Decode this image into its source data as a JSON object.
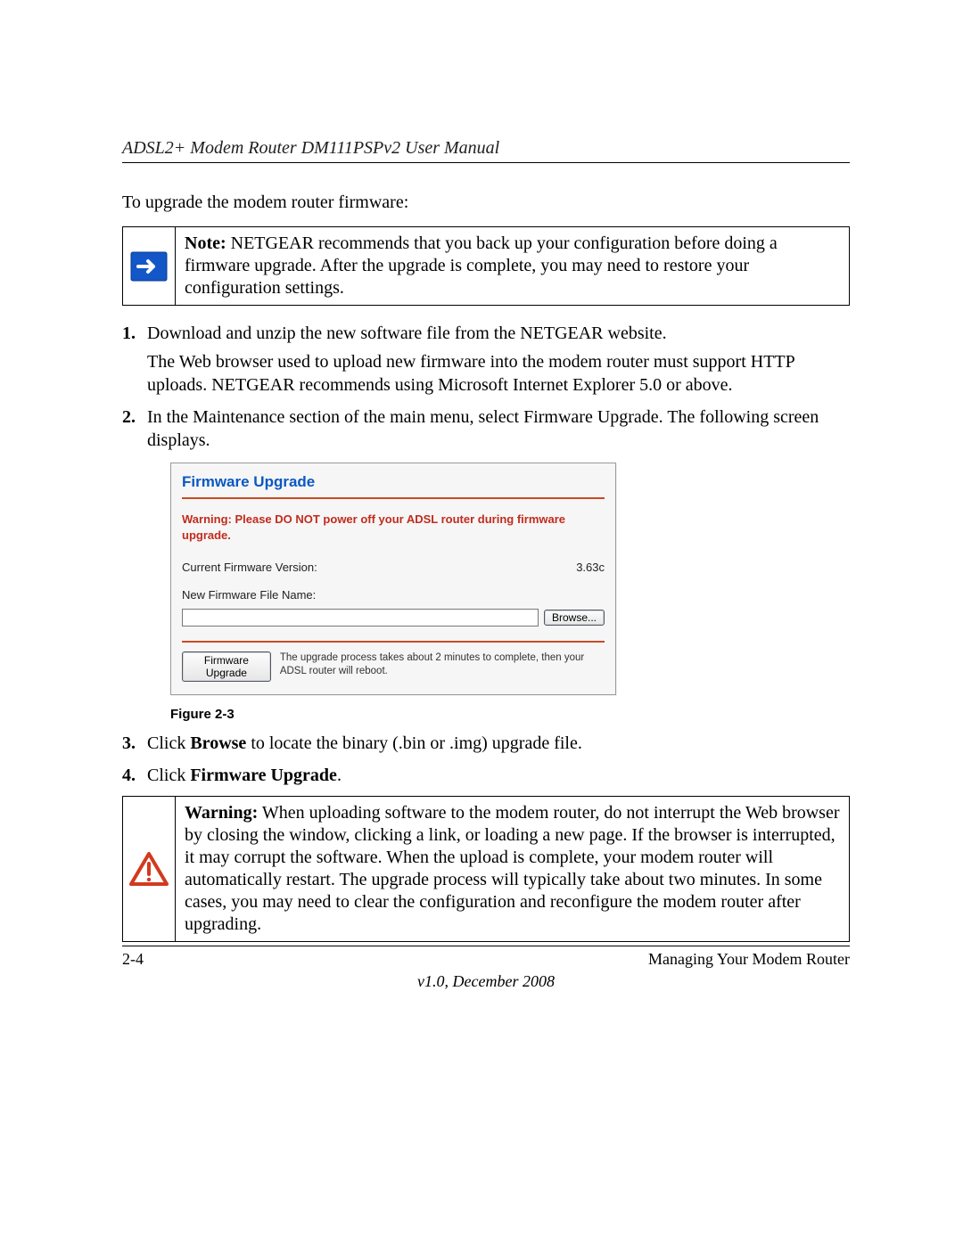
{
  "header": {
    "running_title": "ADSL2+ Modem Router DM111PSPv2 User Manual"
  },
  "intro_text": "To upgrade the modem router firmware:",
  "note_box": {
    "label": "Note:",
    "text": " NETGEAR recommends that you back up your configuration before doing a firmware upgrade. After the upgrade is complete, you may need to restore your configuration settings."
  },
  "steps": {
    "s1_p1": "Download and unzip the new software file from the NETGEAR website.",
    "s1_p2": "The Web browser used to upload new firmware into the modem router must support HTTP uploads. NETGEAR recommends using Microsoft Internet Explorer 5.0 or above.",
    "s2": "In the Maintenance section of the main menu, select Firmware Upgrade. The following screen displays.",
    "s3_pre": "Click ",
    "s3_bold": "Browse",
    "s3_post": " to locate the binary (.bin or .img) upgrade file.",
    "s4_pre": "Click ",
    "s4_bold": "Firmware Upgrade",
    "s4_post": "."
  },
  "screenshot": {
    "title": "Firmware Upgrade",
    "warning": "Warning: Please DO NOT power off your ADSL router during firmware upgrade.",
    "version_label": "Current Firmware Version:",
    "version_value": "3.63c",
    "newfile_label": "New Firmware File Name:",
    "file_value": "",
    "browse_btn": "Browse...",
    "upgrade_btn": "Firmware Upgrade",
    "hint": "The upgrade process takes about 2 minutes to complete, then your ADSL router will reboot."
  },
  "figure_caption": "Figure 2-3",
  "warning_box": {
    "label": "Warning:",
    "text": " When uploading software to the modem router, do not interrupt the Web browser by closing the window, clicking a link, or loading a new page. If the browser is interrupted, it may corrupt the software. When the upload is complete, your modem router will automatically restart. The upgrade process will typically take about two minutes. In some cases, you may need to clear the configuration and reconfigure the modem router after upgrading."
  },
  "footer": {
    "page_num": "2-4",
    "section": "Managing Your Modem Router",
    "version": "v1.0, December 2008"
  }
}
